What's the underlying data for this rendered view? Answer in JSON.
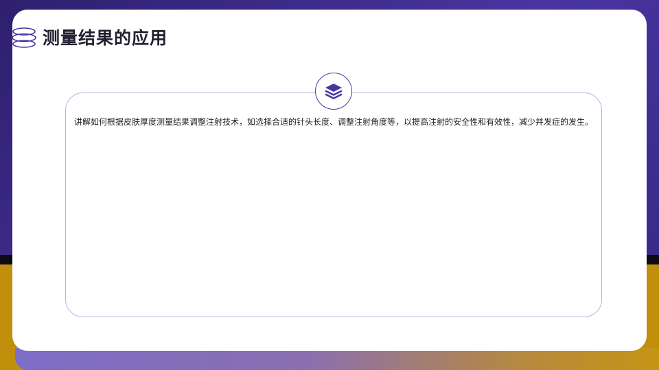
{
  "slide": {
    "title": "测量结果的应用",
    "body": "讲解如何根据皮肤厚度测量结果调整注射技术，如选择合适的针头长度、调整注射角度等，以提高注射的安全性和有效性，减少并发症的发生。",
    "title_icon": "rings-icon",
    "badge_icon": "layers-icon"
  },
  "colors": {
    "accent_purple": "#4a35a0",
    "accent_gold": "#c08f0c",
    "text": "#1f1f2e"
  }
}
